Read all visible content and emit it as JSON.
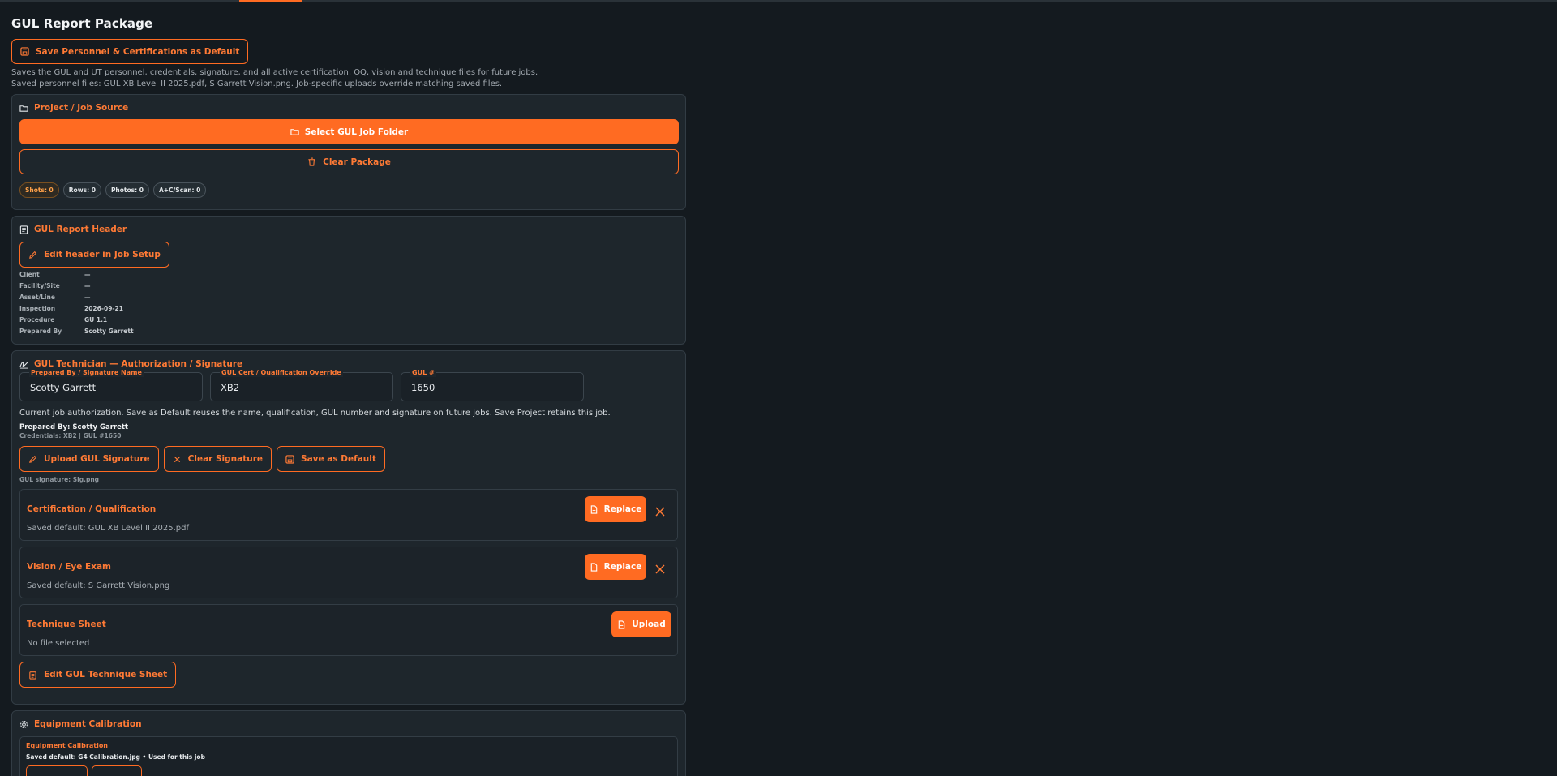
{
  "page": {
    "title": "GUL Report Package",
    "save_default_label": "Save Personnel & Certifications as Default",
    "note_line1": "Saves the GUL and UT personnel, credentials, signature, and all active certification, OQ, vision and technique files for future jobs.",
    "note_line2": "Saved personnel files: GUL XB Level II 2025.pdf, S Garrett Vision.png. Job-specific uploads override matching saved files."
  },
  "project": {
    "title": "Project / Job Source",
    "select_label": "Select GUL Job Folder",
    "clear_label": "Clear Package",
    "chips": [
      "Shots: 0",
      "Rows: 0",
      "Photos: 0",
      "A+C/Scan: 0"
    ]
  },
  "header_card": {
    "title": "GUL Report Header",
    "edit_label": "Edit header in Job Setup",
    "rows": [
      {
        "k": "Client",
        "v": "—"
      },
      {
        "k": "Facility/Site",
        "v": "—"
      },
      {
        "k": "Asset/Line",
        "v": "—"
      },
      {
        "k": "Inspection",
        "v": "2026-09-21"
      },
      {
        "k": "Procedure",
        "v": "GU 1.1"
      },
      {
        "k": "Prepared By",
        "v": "Scotty Garrett"
      }
    ]
  },
  "technician": {
    "title": "GUL Technician — Authorization / Signature",
    "fields": {
      "name_label": "Prepared By / Signature Name",
      "name_value": "Scotty Garrett",
      "cert_label": "GUL Cert / Qualification Override",
      "cert_value": "XB2",
      "num_label": "GUL #",
      "num_value": "1650"
    },
    "description": "Current job authorization. Save as Default reuses the name, qualification, GUL number and signature on future jobs. Save Project retains this job.",
    "prepared_by": "Prepared By: Scotty Garrett",
    "credentials": "Credentials: XB2 | GUL #1650",
    "upload_sig_label": "Upload GUL Signature",
    "clear_sig_label": "Clear Signature",
    "save_default_label": "Save as Default",
    "signature_file": "GUL signature: Sig.png",
    "files": [
      {
        "title": "Certification / Qualification",
        "status": "Saved default: GUL XB Level II 2025.pdf",
        "action": "Replace"
      },
      {
        "title": "Vision / Eye Exam",
        "status": "Saved default: S Garrett Vision.png",
        "action": "Replace"
      },
      {
        "title": "Technique Sheet",
        "status": "No file selected",
        "action": "Upload"
      }
    ],
    "edit_technique_label": "Edit GUL Technique Sheet"
  },
  "equipment": {
    "title": "Equipment Calibration",
    "sub_title": "Equipment Calibration",
    "sub_status": "Saved default: G4 Calibration.jpg • Used for this job"
  },
  "colors": {
    "accent": "#ff6b22",
    "background": "#141a1f",
    "card": "#1e262c"
  }
}
